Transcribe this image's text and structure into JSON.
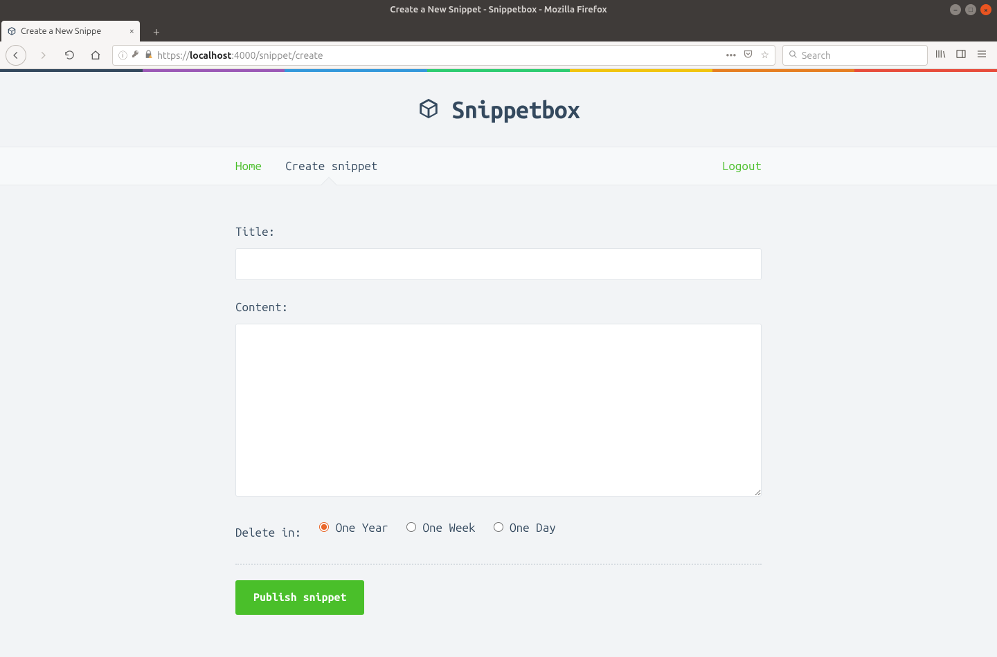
{
  "window": {
    "title": "Create a New Snippet - Snippetbox - Mozilla Firefox"
  },
  "tab": {
    "title": "Create a New Snippe"
  },
  "addressbar": {
    "scheme": "https://",
    "host_bold": "localhost",
    "rest": ":4000/snippet/create"
  },
  "searchbox": {
    "placeholder": "Search"
  },
  "rainbow_colors": [
    "#34495e",
    "#9b59b6",
    "#3498db",
    "#2ecc71",
    "#f1c40f",
    "#e67e22",
    "#e74c3c"
  ],
  "brand": {
    "name": "Snippetbox"
  },
  "nav": {
    "home": "Home",
    "create": "Create snippet",
    "logout": "Logout"
  },
  "form": {
    "title_label": "Title:",
    "title_value": "",
    "content_label": "Content:",
    "content_value": "",
    "delete_label": "Delete in:",
    "options": {
      "year": "One Year",
      "week": "One Week",
      "day": "One Day"
    },
    "selected": "year",
    "submit": "Publish snippet"
  }
}
